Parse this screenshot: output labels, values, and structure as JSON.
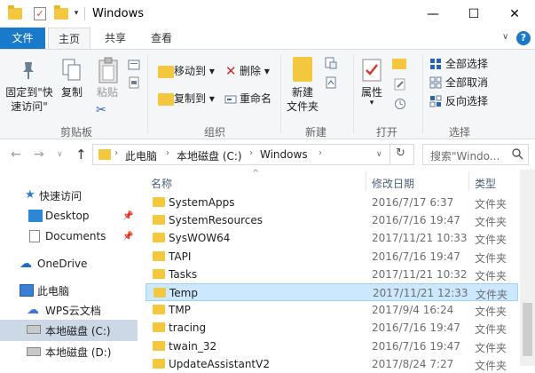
{
  "window": {
    "title": "Windows",
    "quick_access_toolbar": [
      "folder-icon",
      "properties-check-icon",
      "new-folder-icon"
    ],
    "buttons": {
      "minimize": "—",
      "maximize": "☐",
      "close": "✕"
    }
  },
  "tabs": [
    {
      "label": "文件"
    },
    {
      "label": "主页"
    },
    {
      "label": "共享"
    },
    {
      "label": "查看"
    }
  ],
  "ribbon": {
    "clipboard": {
      "group_label": "剪贴板",
      "pin_label_line1": "固定到\"快",
      "pin_label_line2": "速访问\"",
      "copy_label": "复制",
      "paste_label": "粘贴"
    },
    "organize": {
      "group_label": "组织",
      "move_to": "移动到",
      "copy_to": "复制到",
      "delete": "删除",
      "rename": "重命名"
    },
    "new": {
      "group_label": "新建",
      "new_folder_line1": "新建",
      "new_folder_line2": "文件夹"
    },
    "open": {
      "group_label": "打开",
      "properties": "属性"
    },
    "select": {
      "group_label": "选择",
      "select_all": "全部选择",
      "select_none": "全部取消",
      "invert": "反向选择"
    }
  },
  "address": {
    "crumbs": [
      "此电脑",
      "本地磁盘 (C:)",
      "Windows"
    ],
    "search_placeholder": "搜索\"Windo..."
  },
  "navpane": {
    "items": [
      {
        "label": "快速访问",
        "icon": "star-icon"
      },
      {
        "label": "Desktop",
        "icon": "desktop-icon",
        "pinned": true
      },
      {
        "label": "Documents",
        "icon": "documents-icon",
        "pinned": true
      },
      {
        "label": "OneDrive",
        "icon": "cloud-icon"
      },
      {
        "label": "此电脑",
        "icon": "computer-icon"
      },
      {
        "label": "WPS云文档",
        "icon": "wps-cloud-icon"
      },
      {
        "label": "本地磁盘 (C:)",
        "icon": "drive-icon",
        "selected": true
      },
      {
        "label": "本地磁盘 (D:)",
        "icon": "drive-icon"
      }
    ]
  },
  "filelist": {
    "columns": {
      "name": "名称",
      "date": "修改日期",
      "type": "类型"
    },
    "rows": [
      {
        "name": "SystemApps",
        "date": "2016/7/17 6:37",
        "type": "文件夹"
      },
      {
        "name": "SystemResources",
        "date": "2016/7/16 19:47",
        "type": "文件夹"
      },
      {
        "name": "SysWOW64",
        "date": "2017/11/21 10:33",
        "type": "文件夹"
      },
      {
        "name": "TAPI",
        "date": "2016/7/16 19:47",
        "type": "文件夹"
      },
      {
        "name": "Tasks",
        "date": "2017/11/21 10:32",
        "type": "文件夹"
      },
      {
        "name": "Temp",
        "date": "2017/11/21 12:33",
        "type": "文件夹",
        "selected": true
      },
      {
        "name": "TMP",
        "date": "2017/9/4 16:24",
        "type": "文件夹"
      },
      {
        "name": "tracing",
        "date": "2016/7/16 19:47",
        "type": "文件夹"
      },
      {
        "name": "twain_32",
        "date": "2016/7/16 19:47",
        "type": "文件夹"
      },
      {
        "name": "UpdateAssistantV2",
        "date": "2017/8/24 7:27",
        "type": "文件夹"
      }
    ]
  }
}
